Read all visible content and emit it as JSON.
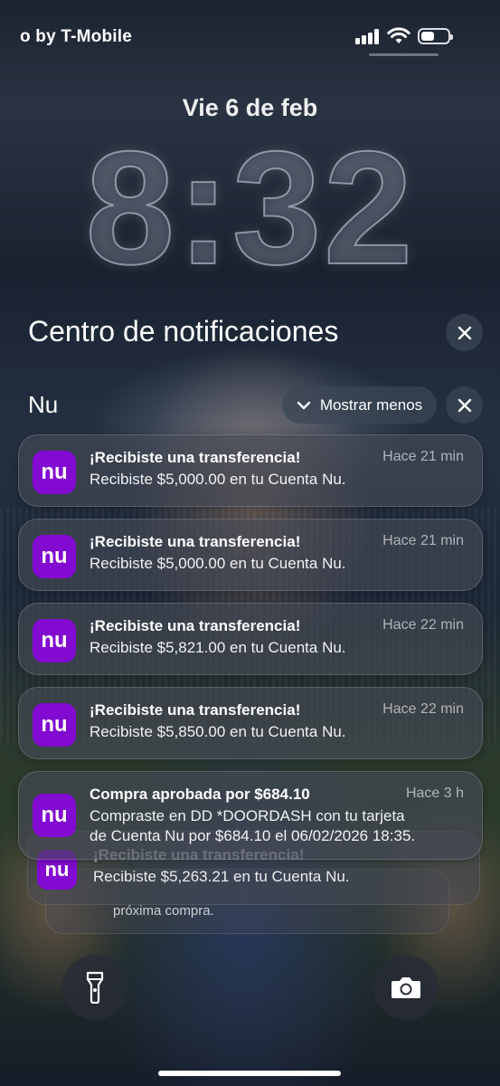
{
  "status_bar": {
    "carrier": "o by T-Mobile"
  },
  "lock_screen": {
    "date": "Vie 6 de feb",
    "time": "8:32"
  },
  "notification_center": {
    "title": "Centro de notificaciones",
    "group": {
      "app_name": "Nu",
      "show_less_label": "Mostrar menos",
      "app_icon_text": "nu"
    },
    "notifications": [
      {
        "title": "¡Recibiste una transferencia!",
        "body": "Recibiste $5,000.00 en tu Cuenta Nu.",
        "time": "Hace 21 min"
      },
      {
        "title": "¡Recibiste una transferencia!",
        "body": "Recibiste $5,000.00 en tu Cuenta Nu.",
        "time": "Hace 21 min"
      },
      {
        "title": "¡Recibiste una transferencia!",
        "body": "Recibiste $5,821.00 en tu Cuenta Nu.",
        "time": "Hace 22 min"
      },
      {
        "title": "¡Recibiste una transferencia!",
        "body": "Recibiste $5,850.00 en tu Cuenta Nu.",
        "time": "Hace 22 min"
      },
      {
        "title": "Compra aprobada por $684.10",
        "body_line1": "Compraste en DD *DOORDASH con tu tarjeta",
        "body_line2": "de Cuenta Nu por $684.10 el 06/02/2026 18:35.",
        "time": "Hace 3 h"
      }
    ],
    "stacked": [
      {
        "title": "¡Recibiste una transferencia!",
        "body": "Recibiste $5,263.21 en tu Cuenta Nu."
      },
      {
        "body": "próxima compra."
      }
    ]
  },
  "quick_actions": {
    "flashlight_icon": "flashlight-icon",
    "camera_icon": "camera-icon"
  },
  "colors": {
    "nu_purple": "#820ad1"
  }
}
